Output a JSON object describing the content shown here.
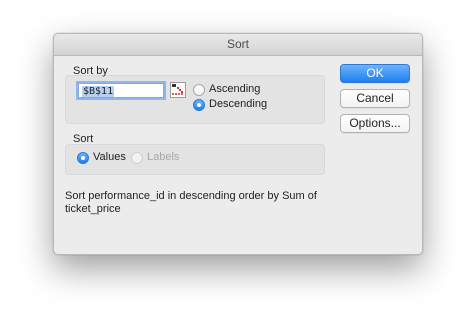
{
  "dialog": {
    "title": "Sort",
    "sort_by": {
      "label": "Sort by",
      "reference": "$B$11",
      "range_picker_icon": "range-select-icon",
      "options": [
        {
          "label": "Ascending",
          "selected": false
        },
        {
          "label": "Descending",
          "selected": true
        }
      ]
    },
    "sort": {
      "label": "Sort",
      "options": [
        {
          "label": "Values",
          "selected": true,
          "enabled": true
        },
        {
          "label": "Labels",
          "selected": false,
          "enabled": false
        }
      ]
    },
    "description": "Sort performance_id in descending order by Sum of ticket_price",
    "buttons": {
      "ok": "OK",
      "cancel": "Cancel",
      "options": "Options..."
    },
    "colors": {
      "accent": "#1c7ff0",
      "dialog_bg": "#ececec",
      "group_bg": "#e3e3e3"
    }
  }
}
